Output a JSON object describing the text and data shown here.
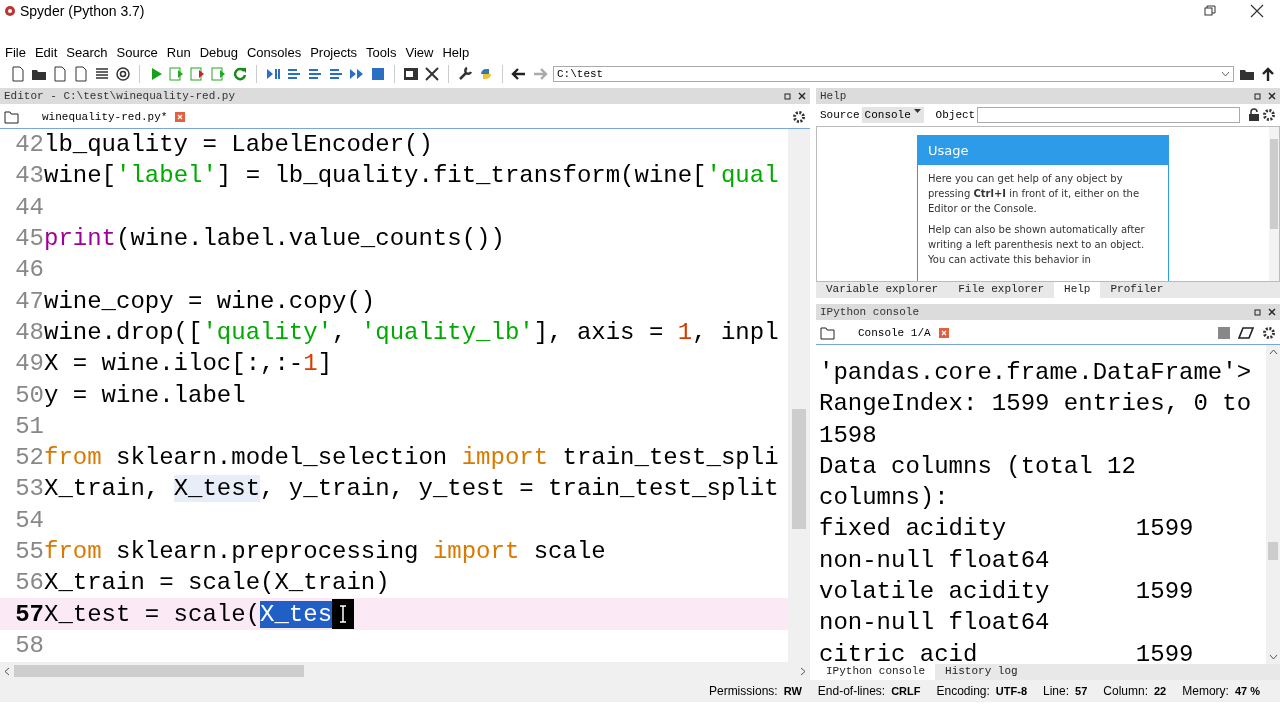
{
  "window": {
    "title": "Spyder (Python 3.7)"
  },
  "menu": [
    "File",
    "Edit",
    "Search",
    "Source",
    "Run",
    "Debug",
    "Consoles",
    "Projects",
    "Tools",
    "View",
    "Help"
  ],
  "toolbar": {
    "path": "C:\\test"
  },
  "editor": {
    "title": "Editor - C:\\test\\winequality-red.py",
    "tabs": [
      {
        "label": "winequality-red.py*",
        "selected": true
      }
    ],
    "lines": [
      {
        "number": "42",
        "current": false,
        "tokens": [
          {
            "kind": "plain",
            "text": "lb_quality = LabelEncoder()"
          }
        ]
      },
      {
        "number": "43",
        "current": false,
        "tokens": [
          {
            "kind": "plain",
            "text": "wine["
          },
          {
            "kind": "string",
            "text": "'label'"
          },
          {
            "kind": "plain",
            "text": "] = lb_quality.fit_transform(wine["
          },
          {
            "kind": "string",
            "text": "'qual"
          }
        ]
      },
      {
        "number": "44",
        "current": false
      },
      {
        "number": "45",
        "current": false,
        "tokens": [
          {
            "kind": "builtin",
            "text": "print"
          },
          {
            "kind": "plain",
            "text": "(wine.label.value_counts())"
          }
        ]
      },
      {
        "number": "46",
        "current": false
      },
      {
        "number": "47",
        "current": false,
        "tokens": [
          {
            "kind": "plain",
            "text": "wine_copy = wine.copy()"
          }
        ]
      },
      {
        "number": "48",
        "current": false,
        "tokens": [
          {
            "kind": "plain",
            "text": "wine.drop(["
          },
          {
            "kind": "string",
            "text": "'quality'"
          },
          {
            "kind": "plain",
            "text": ", "
          },
          {
            "kind": "string",
            "text": "'quality_lb'"
          },
          {
            "kind": "plain",
            "text": "], axis = "
          },
          {
            "kind": "number",
            "text": "1"
          },
          {
            "kind": "plain",
            "text": ", inpl"
          }
        ]
      },
      {
        "number": "49",
        "current": false,
        "tokens": [
          {
            "kind": "plain",
            "text": "X = wine.iloc[:,:-"
          },
          {
            "kind": "number",
            "text": "1"
          },
          {
            "kind": "plain",
            "text": "]"
          }
        ]
      },
      {
        "number": "50",
        "current": false,
        "tokens": [
          {
            "kind": "plain",
            "text": "y = wine.label"
          }
        ]
      },
      {
        "number": "51",
        "current": false
      },
      {
        "number": "52",
        "current": false,
        "tokens": [
          {
            "kind": "keyword",
            "text": "from"
          },
          {
            "kind": "plain",
            "text": " sklearn.model_selection "
          },
          {
            "kind": "keyword",
            "text": "import"
          },
          {
            "kind": "plain",
            "text": " train_test_spli"
          }
        ]
      },
      {
        "number": "53",
        "current": false,
        "tokens": [
          {
            "kind": "plain",
            "text": "X_train, "
          },
          {
            "kind": "occurrence",
            "text": "X_test"
          },
          {
            "kind": "plain",
            "text": ", y_train, y_test = train_test_split"
          }
        ]
      },
      {
        "number": "54",
        "current": false
      },
      {
        "number": "55",
        "current": false,
        "tokens": [
          {
            "kind": "keyword",
            "text": "from"
          },
          {
            "kind": "plain",
            "text": " sklearn.preprocessing "
          },
          {
            "kind": "keyword",
            "text": "import"
          },
          {
            "kind": "plain",
            "text": " scale"
          }
        ]
      },
      {
        "number": "56",
        "current": false,
        "tokens": [
          {
            "kind": "plain",
            "text": "X_train = scale(X_train)"
          }
        ]
      },
      {
        "number": "57",
        "current": true,
        "tokens": [
          {
            "kind": "plain",
            "text": "X_test = scale("
          },
          {
            "kind": "selection",
            "text": "X_tes"
          }
        ]
      },
      {
        "number": "58",
        "current": false
      }
    ]
  },
  "help": {
    "title": "Help",
    "source_label": "Source",
    "source_value": "Console",
    "object_label": "Object",
    "card_title": "Usage",
    "paragraphs": [
      "Here you can get help of any object by pressing **Ctrl+I** in front of it, either on the Editor or the Console.",
      "Help can also be shown automatically after writing a left parenthesis next to an object. You can activate this behavior in"
    ],
    "tabs": [
      {
        "label": "Variable explorer",
        "selected": false
      },
      {
        "label": "File explorer",
        "selected": false
      },
      {
        "label": "Help",
        "selected": true
      },
      {
        "label": "Profiler",
        "selected": false
      }
    ]
  },
  "console": {
    "title": "IPython console",
    "tabs": [
      {
        "label": "Console 1/A",
        "selected": true
      }
    ],
    "lines": [
      "'pandas.core.frame.DataFrame'>",
      "RangeIndex: 1599 entries, 0 to",
      "1598",
      "Data columns (total 12",
      "columns):",
      "fixed acidity         1599",
      "non-null float64",
      "volatile acidity      1599",
      "non-null float64",
      "citric acid           1599"
    ],
    "bottom_tabs": [
      {
        "label": "IPython console",
        "selected": true
      },
      {
        "label": "History log",
        "selected": false
      }
    ]
  },
  "status_bar": [
    {
      "label": "Permissions:",
      "value": "RW"
    },
    {
      "label": "End-of-lines:",
      "value": "CRLF"
    },
    {
      "label": "Encoding:",
      "value": "UTF-8"
    },
    {
      "label": "Line:",
      "value": "57"
    },
    {
      "label": "Column:",
      "value": "22"
    },
    {
      "label": "Memory:",
      "value": "47 %"
    }
  ]
}
